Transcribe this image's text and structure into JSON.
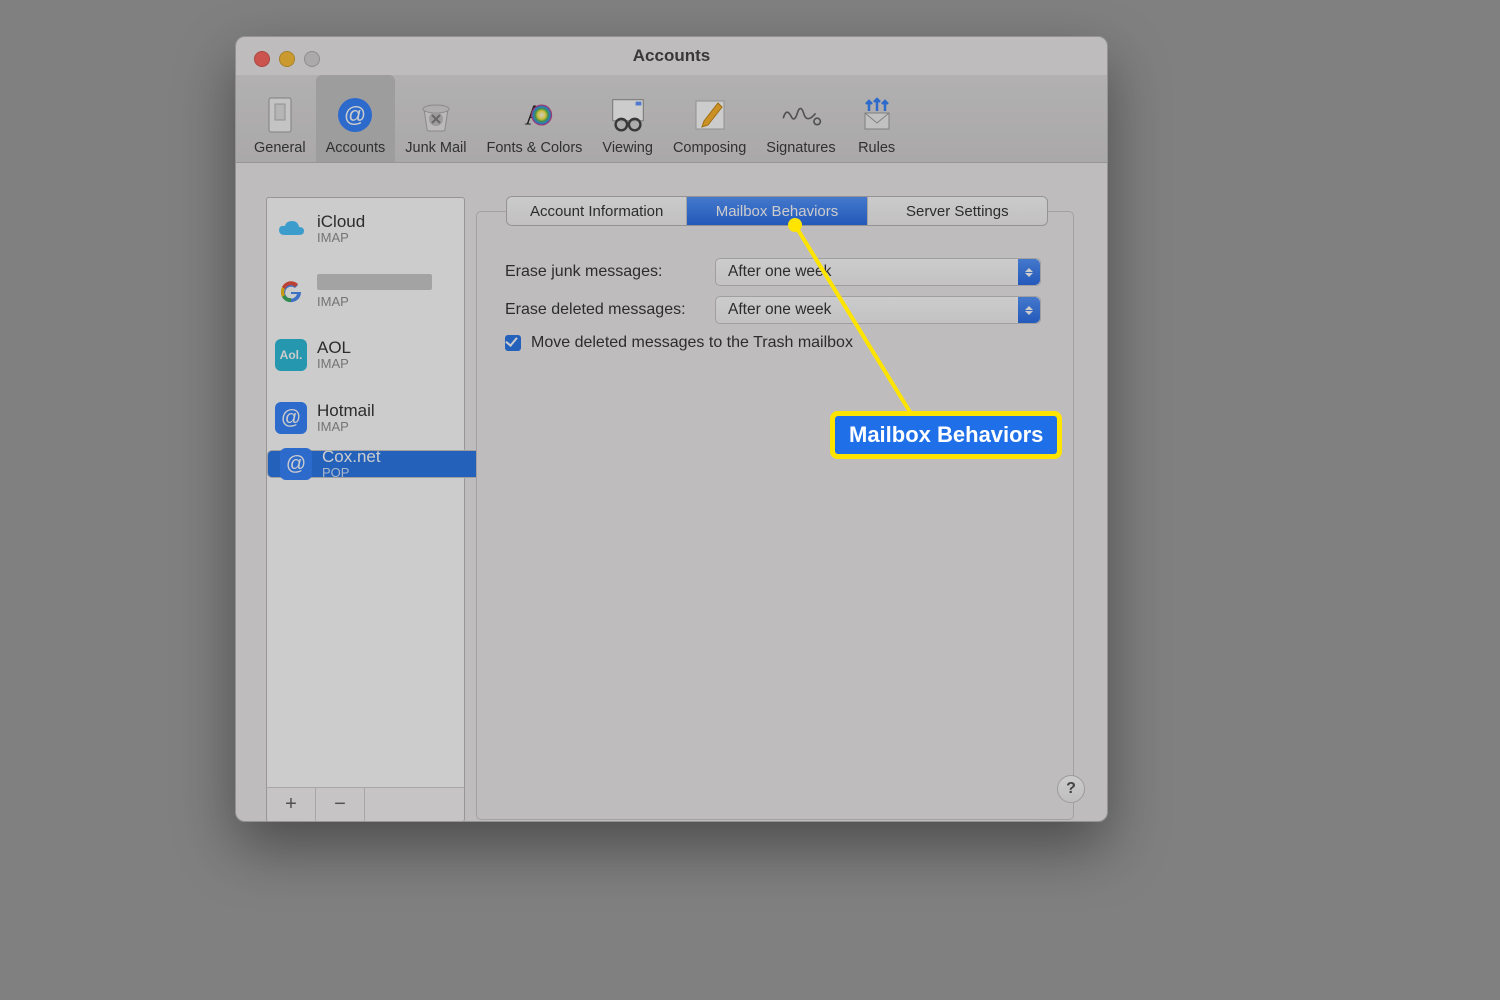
{
  "window": {
    "title": "Accounts"
  },
  "toolbar": {
    "items": [
      {
        "label": "General"
      },
      {
        "label": "Accounts"
      },
      {
        "label": "Junk Mail"
      },
      {
        "label": "Fonts & Colors"
      },
      {
        "label": "Viewing"
      },
      {
        "label": "Composing"
      },
      {
        "label": "Signatures"
      },
      {
        "label": "Rules"
      }
    ],
    "selected_index": 1
  },
  "accounts": [
    {
      "name": "iCloud",
      "protocol": "IMAP",
      "icon": "cloud"
    },
    {
      "name": "",
      "protocol": "IMAP",
      "icon": "google",
      "redacted": true
    },
    {
      "name": "AOL",
      "protocol": "IMAP",
      "icon": "aol"
    },
    {
      "name": "Hotmail",
      "protocol": "IMAP",
      "icon": "at"
    },
    {
      "name": "Cox.net",
      "protocol": "POP",
      "icon": "at",
      "selected": true
    }
  ],
  "tabs": {
    "items": [
      "Account Information",
      "Mailbox Behaviors",
      "Server Settings"
    ],
    "active_index": 1
  },
  "settings": {
    "erase_junk_label": "Erase junk messages:",
    "erase_junk_value": "After one week",
    "erase_deleted_label": "Erase deleted messages:",
    "erase_deleted_value": "After one week",
    "move_deleted_label": "Move deleted messages to the Trash mailbox",
    "move_deleted_checked": true
  },
  "buttons": {
    "add": "+",
    "remove": "−",
    "help": "?"
  },
  "annotation": {
    "label": "Mailbox Behaviors"
  }
}
